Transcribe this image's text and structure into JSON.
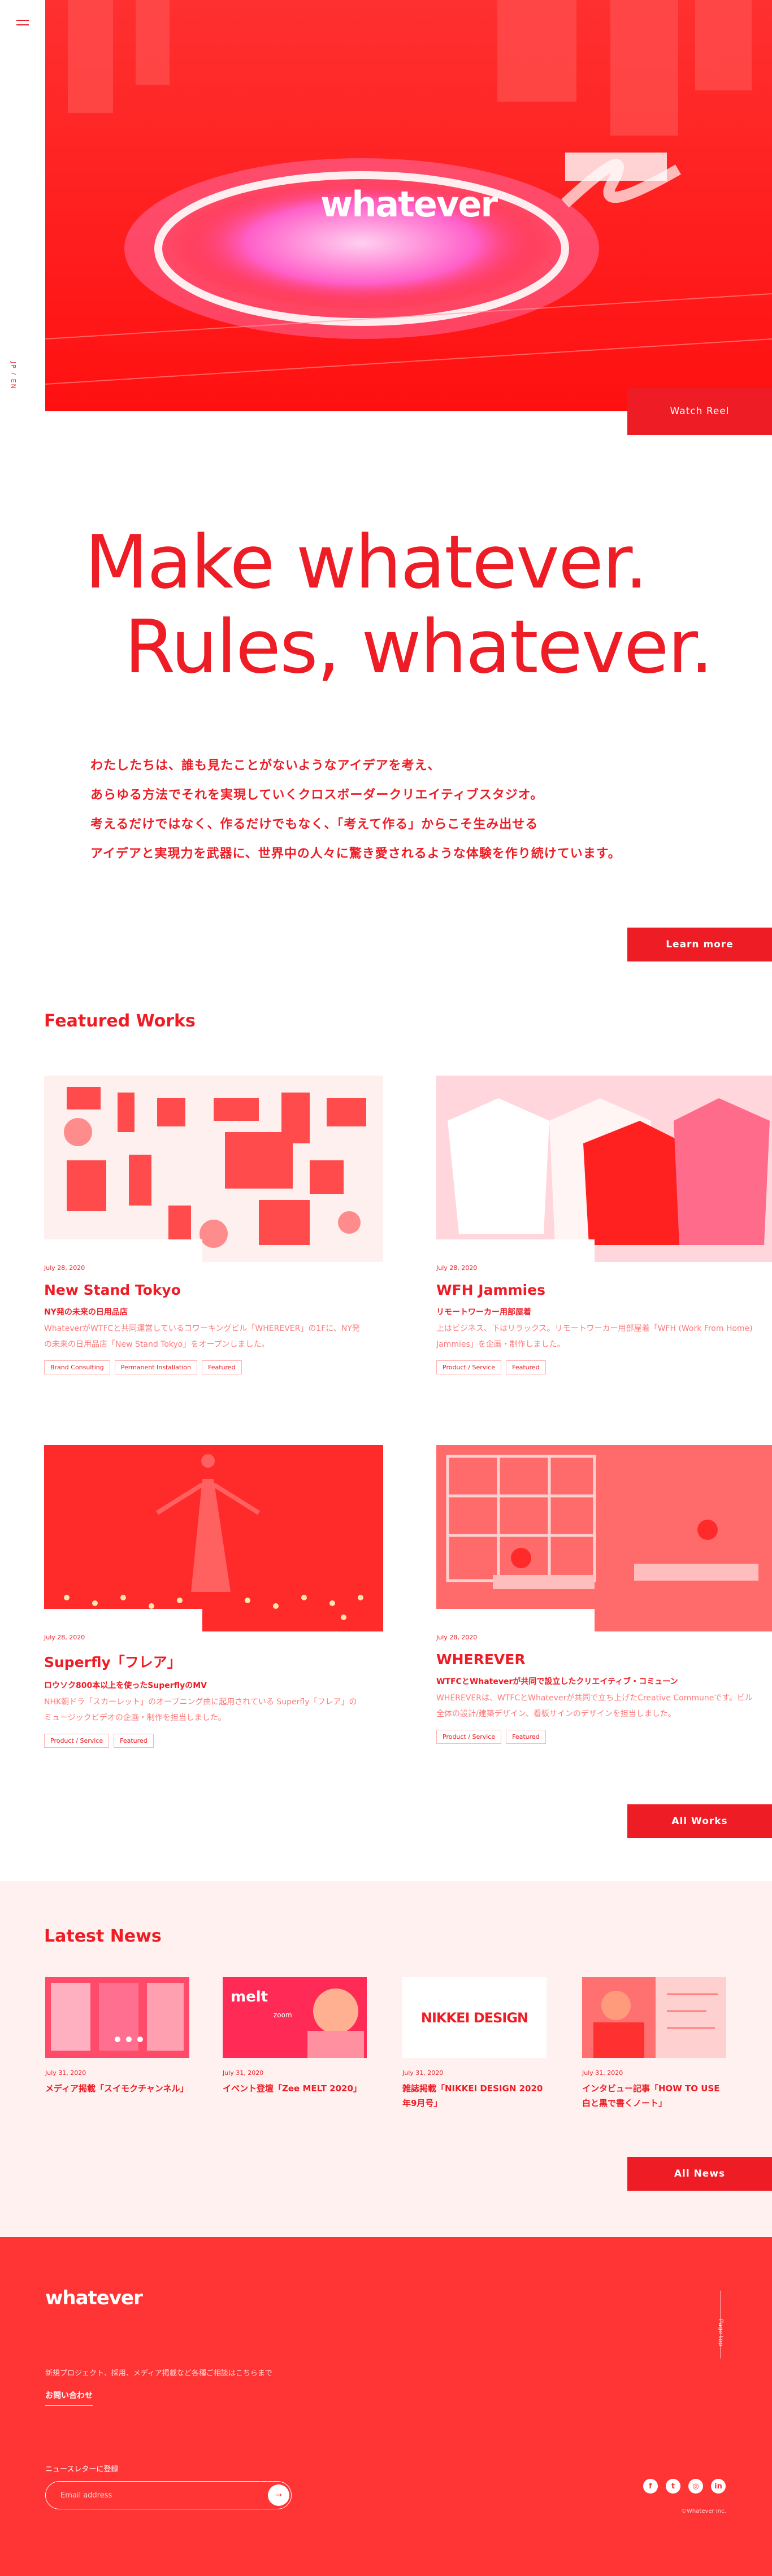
{
  "hero": {
    "logo": "whatever",
    "watch_reel": "Watch Reel"
  },
  "headline": {
    "line1": "Make whatever.",
    "line2": "Rules, whatever."
  },
  "intro": [
    "わたしたちは、誰も見たことがないようなアイデアを考え、",
    "あらゆる方法でそれを実現していくクロスボーダークリエイティブスタジオ。",
    "考えるだけではなく、作るだけでもなく、「考えて作る」からこそ生み出せる",
    "アイデアと実現力を武器に、世界中の人々に驚き愛されるような体験を作り続けています。"
  ],
  "learn_more": "Learn more",
  "featured": {
    "title": "Featured Works",
    "all_label": "All Works",
    "items": [
      {
        "date": "July 28, 2020",
        "title": "New Stand Tokyo",
        "sub": "NY発の未来の日用品店",
        "desc": "WhateverがWTFCと共同運営しているコワーキングビル「WHEREVER」の1Fに、NY発の未来の日用品店「New Stand Tokyo」をオープンしました。",
        "tags": [
          "Brand Consulting",
          "Permanent Installation",
          "Featured"
        ]
      },
      {
        "date": "July 28, 2020",
        "title": "WFH Jammies",
        "sub": "リモートワーカー用部屋着",
        "desc": "上はビジネス、下はリラックス。リモートワーカー用部屋着「WFH (Work From Home) Jammies」を企画・制作しました。",
        "tags": [
          "Product / Service",
          "Featured"
        ]
      },
      {
        "date": "July 28, 2020",
        "title": "Superfly「フレア」",
        "sub": "ロウソク800本以上を使ったSuperflyのMV",
        "desc": "NHK朝ドラ「スカーレット」のオープニング曲に起用されている Superfly「フレア」のミュージックビデオの企画・制作を担当しました。",
        "tags": [
          "Product / Service",
          "Featured"
        ]
      },
      {
        "date": "July 28, 2020",
        "title": "WHEREVER",
        "sub": "WTFCとWhateverが共同で設立したクリエイティブ・コミューン",
        "desc": "WHEREVERは、WTFCとWhateverが共同で立ち上げたCreative Communeです。ビル全体の設計/建築デザイン、看板サインのデザインを担当しました。",
        "tags": [
          "Product / Service",
          "Featured"
        ]
      }
    ]
  },
  "news": {
    "title": "Latest News",
    "all_label": "All News",
    "items": [
      {
        "date": "July 31, 2020",
        "title": "メディア掲載「スイモクチャンネル」"
      },
      {
        "date": "July 31, 2020",
        "title": "イベント登壇「Zee MELT 2020」"
      },
      {
        "date": "July 31, 2020",
        "title": "雑誌掲載「NIKKEI DESIGN 2020年9月号」"
      },
      {
        "date": "July 31, 2020",
        "title": "インタビュー記事「HOW TO USE 白と黒で書くノート」"
      }
    ],
    "thumb2_text1": "melt",
    "thumb2_text2": "zoom",
    "thumb3_text": "NIKKEI DESIGN"
  },
  "footer": {
    "logo": "whatever",
    "text": "新規プロジェクト、採用、メディア掲載など各種ご相談はこちらまで",
    "contact": "お問い合わせ",
    "newsletter": "ニュースレターに登録",
    "email_placeholder": "Email address",
    "submit": "→",
    "pagetop": "Page top",
    "social": [
      "f",
      "t",
      "◎",
      "in"
    ],
    "copyright": "©Whatever Inc."
  },
  "lang": "JP / EN",
  "colors": {
    "accent": "#ee1c25",
    "footer": "#ff3434",
    "news_bg": "#fff1f0"
  }
}
